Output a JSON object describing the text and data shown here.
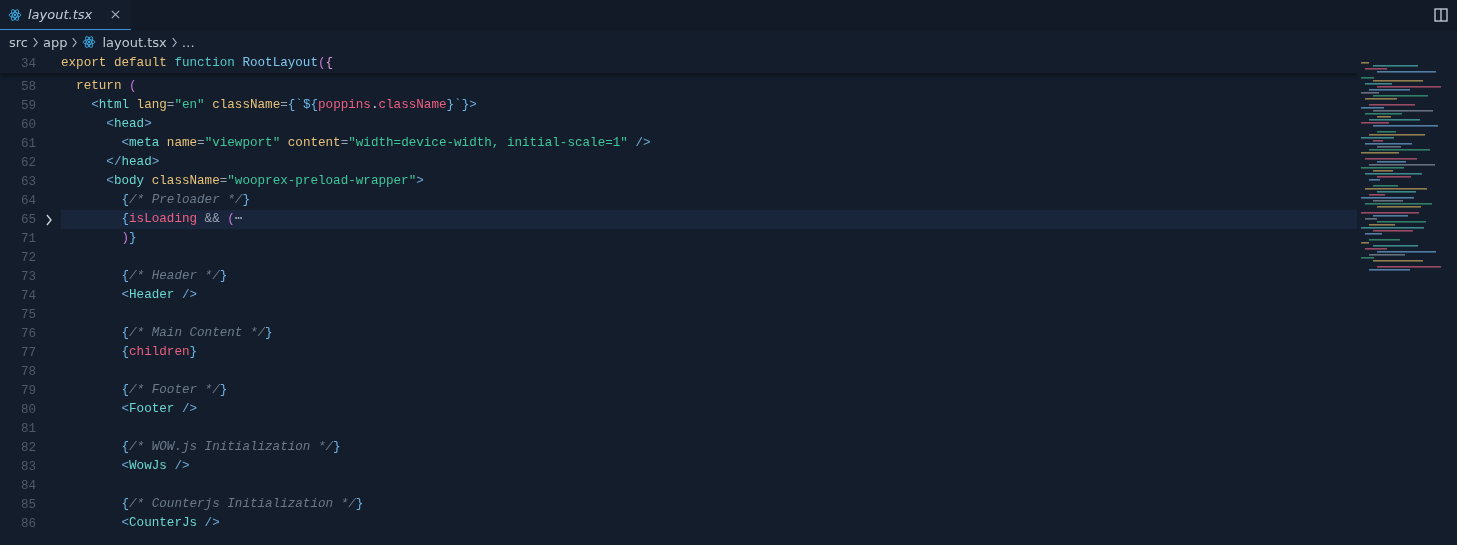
{
  "tabs": [
    {
      "title": "layout.tsx",
      "selected": true
    }
  ],
  "breadcrumb": [
    {
      "text": "src",
      "kind": "folder"
    },
    {
      "text": "app",
      "kind": "folder"
    },
    {
      "text": "layout.tsx",
      "kind": "file"
    },
    {
      "text": "…",
      "kind": "more"
    }
  ],
  "sticky_line": {
    "number": "34",
    "tokens": [
      {
        "kind": "kw",
        "text": "export default "
      },
      {
        "kind": "fn",
        "text": "function "
      },
      {
        "kind": "name",
        "text": "RootLayout"
      },
      {
        "kind": "paren",
        "text": "("
      },
      {
        "kind": "brace2",
        "text": "{"
      }
    ]
  },
  "lines": [
    {
      "number": "58",
      "folded": false,
      "selected": false,
      "tokens": [
        {
          "kind": "kw",
          "text": "  return "
        },
        {
          "kind": "paren",
          "text": "("
        }
      ]
    },
    {
      "number": "59",
      "folded": false,
      "selected": false,
      "tokens": [
        {
          "kind": "tagp",
          "text": "    <"
        },
        {
          "kind": "tag",
          "text": "html "
        },
        {
          "kind": "attr",
          "text": "lang"
        },
        {
          "kind": "op",
          "text": "="
        },
        {
          "kind": "str",
          "text": "\"en\" "
        },
        {
          "kind": "attr",
          "text": "className"
        },
        {
          "kind": "op",
          "text": "="
        },
        {
          "kind": "brace",
          "text": "{`${"
        },
        {
          "kind": "var",
          "text": "poppins"
        },
        {
          "kind": "plain",
          "text": "."
        },
        {
          "kind": "var",
          "text": "className"
        },
        {
          "kind": "brace",
          "text": "}`}"
        },
        {
          "kind": "tagp",
          "text": ">"
        }
      ]
    },
    {
      "number": "60",
      "folded": false,
      "selected": false,
      "tokens": [
        {
          "kind": "tagp",
          "text": "      <"
        },
        {
          "kind": "tag",
          "text": "head"
        },
        {
          "kind": "tagp",
          "text": ">"
        }
      ]
    },
    {
      "number": "61",
      "folded": false,
      "selected": false,
      "tokens": [
        {
          "kind": "tagp",
          "text": "        <"
        },
        {
          "kind": "tag",
          "text": "meta "
        },
        {
          "kind": "attr",
          "text": "name"
        },
        {
          "kind": "op",
          "text": "="
        },
        {
          "kind": "str",
          "text": "\"viewport\" "
        },
        {
          "kind": "attr",
          "text": "content"
        },
        {
          "kind": "op",
          "text": "="
        },
        {
          "kind": "str",
          "text": "\"width=device-width, initial-scale=1\" "
        },
        {
          "kind": "tagp",
          "text": "/>"
        }
      ]
    },
    {
      "number": "62",
      "folded": false,
      "selected": false,
      "tokens": [
        {
          "kind": "tagp",
          "text": "      </"
        },
        {
          "kind": "tag",
          "text": "head"
        },
        {
          "kind": "tagp",
          "text": ">"
        }
      ]
    },
    {
      "number": "63",
      "folded": false,
      "selected": false,
      "tokens": [
        {
          "kind": "tagp",
          "text": "      <"
        },
        {
          "kind": "tag",
          "text": "body "
        },
        {
          "kind": "attr",
          "text": "className"
        },
        {
          "kind": "op",
          "text": "="
        },
        {
          "kind": "str",
          "text": "\"wooprex-preload-wrapper\""
        },
        {
          "kind": "tagp",
          "text": ">"
        }
      ]
    },
    {
      "number": "64",
      "folded": false,
      "selected": false,
      "tokens": [
        {
          "kind": "brace",
          "text": "        {"
        },
        {
          "kind": "comment",
          "text": "/* Preloader */"
        },
        {
          "kind": "brace",
          "text": "}"
        }
      ]
    },
    {
      "number": "65",
      "folded": true,
      "selected": true,
      "tokens": [
        {
          "kind": "brace",
          "text": "        {"
        },
        {
          "kind": "var",
          "text": "isLoading "
        },
        {
          "kind": "op",
          "text": "&& "
        },
        {
          "kind": "paren",
          "text": "("
        },
        {
          "kind": "op",
          "text": "⋯"
        }
      ]
    },
    {
      "number": "71",
      "folded": false,
      "selected": false,
      "tokens": [
        {
          "kind": "paren",
          "text": "        )"
        },
        {
          "kind": "brace",
          "text": "}"
        }
      ]
    },
    {
      "number": "72",
      "folded": false,
      "selected": false
    },
    {
      "number": "73",
      "folded": false,
      "selected": false,
      "tokens": [
        {
          "kind": "brace",
          "text": "        {"
        },
        {
          "kind": "comment",
          "text": "/* Header */"
        },
        {
          "kind": "brace",
          "text": "}"
        }
      ]
    },
    {
      "number": "74",
      "folded": false,
      "selected": false,
      "tokens": [
        {
          "kind": "tagp",
          "text": "        <"
        },
        {
          "kind": "tag",
          "text": "Header "
        },
        {
          "kind": "tagp",
          "text": "/>"
        }
      ]
    },
    {
      "number": "75",
      "folded": false,
      "selected": false
    },
    {
      "number": "76",
      "folded": false,
      "selected": false,
      "tokens": [
        {
          "kind": "brace",
          "text": "        {"
        },
        {
          "kind": "comment",
          "text": "/* Main Content */"
        },
        {
          "kind": "brace",
          "text": "}"
        }
      ]
    },
    {
      "number": "77",
      "folded": false,
      "selected": false,
      "tokens": [
        {
          "kind": "brace",
          "text": "        {"
        },
        {
          "kind": "var",
          "text": "children"
        },
        {
          "kind": "brace",
          "text": "}"
        }
      ]
    },
    {
      "number": "78",
      "folded": false,
      "selected": false
    },
    {
      "number": "79",
      "folded": false,
      "selected": false,
      "tokens": [
        {
          "kind": "brace",
          "text": "        {"
        },
        {
          "kind": "comment",
          "text": "/* Footer */"
        },
        {
          "kind": "brace",
          "text": "}"
        }
      ]
    },
    {
      "number": "80",
      "folded": false,
      "selected": false,
      "tokens": [
        {
          "kind": "tagp",
          "text": "        <"
        },
        {
          "kind": "tag",
          "text": "Footer "
        },
        {
          "kind": "tagp",
          "text": "/>"
        }
      ]
    },
    {
      "number": "81",
      "folded": false,
      "selected": false
    },
    {
      "number": "82",
      "folded": false,
      "selected": false,
      "tokens": [
        {
          "kind": "brace",
          "text": "        {"
        },
        {
          "kind": "comment",
          "text": "/* WOW.js Initialization */"
        },
        {
          "kind": "brace",
          "text": "}"
        }
      ]
    },
    {
      "number": "83",
      "folded": false,
      "selected": false,
      "tokens": [
        {
          "kind": "tagp",
          "text": "        <"
        },
        {
          "kind": "tag",
          "text": "WowJs "
        },
        {
          "kind": "tagp",
          "text": "/>"
        }
      ]
    },
    {
      "number": "84",
      "folded": false,
      "selected": false
    },
    {
      "number": "85",
      "folded": false,
      "selected": false,
      "tokens": [
        {
          "kind": "brace",
          "text": "        {"
        },
        {
          "kind": "comment",
          "text": "/* Counterjs Initialization */"
        },
        {
          "kind": "brace",
          "text": "}"
        }
      ]
    },
    {
      "number": "86",
      "folded": false,
      "selected": false,
      "tokens": [
        {
          "kind": "tagp",
          "text": "        <"
        },
        {
          "kind": "tag",
          "text": "CounterJs "
        },
        {
          "kind": "tagp",
          "text": "/>"
        }
      ]
    }
  ]
}
